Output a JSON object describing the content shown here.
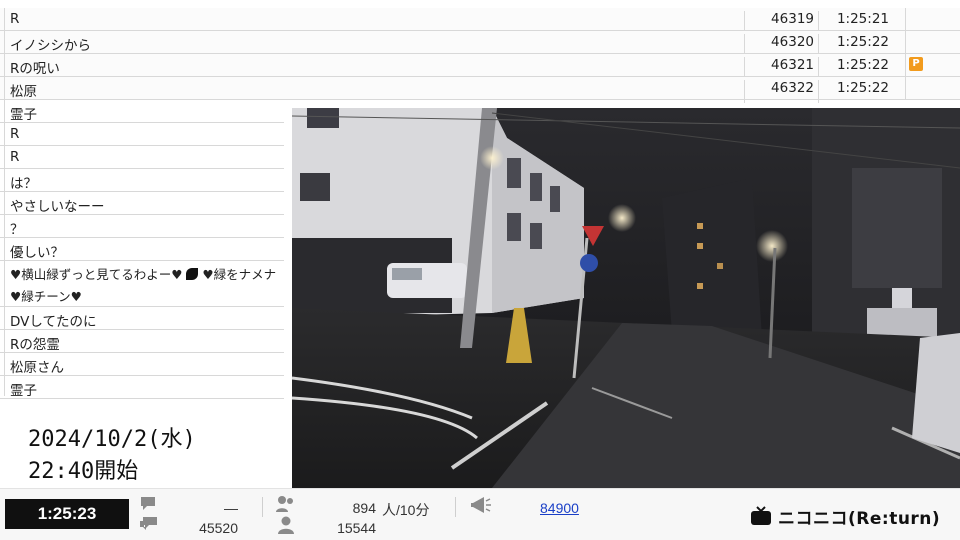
{
  "comments_top": [
    {
      "text": "R",
      "no": "46319",
      "time": "1:25:21",
      "premium": false
    },
    {
      "text": "イノシシから",
      "no": "46320",
      "time": "1:25:22",
      "premium": false
    },
    {
      "text": "Rの呪い",
      "no": "46321",
      "time": "1:25:22",
      "premium": true
    },
    {
      "text": "松原",
      "no": "46322",
      "time": "1:25:22",
      "premium": false
    }
  ],
  "comments_left": [
    "霊子",
    "R",
    "R",
    "は？",
    "やさしいなーー",
    "？",
    "優しい？",
    "♥横山緑ずっと見てるわよー♥",
    "♥緑をナメナ",
    "♥緑チーン♥",
    "DVしてたのに",
    "Rの怨霊",
    "松原さん",
    "霊子"
  ],
  "premium_badge": "P",
  "date_box": {
    "line1": "2024/10/2(水)",
    "line2": "22:40開始"
  },
  "status": {
    "timer": "1:25:23",
    "comment_rate": "—",
    "comment_total": "45520",
    "viewers_rate": "894",
    "viewers_unit": "人/10分",
    "viewers_total": "15544",
    "ad_points": "84900"
  },
  "brand": "ニコニコ(Re:turn)",
  "icons": {
    "comment": "speech-bubble-icon",
    "viewer": "person-icon",
    "ad": "megaphone-icon",
    "brand": "tv-icon",
    "dark_mark": "leaf-icon"
  },
  "colors": {
    "premium": "#f29b1d",
    "timer_bg": "#101010",
    "link": "#1a3fc7"
  }
}
